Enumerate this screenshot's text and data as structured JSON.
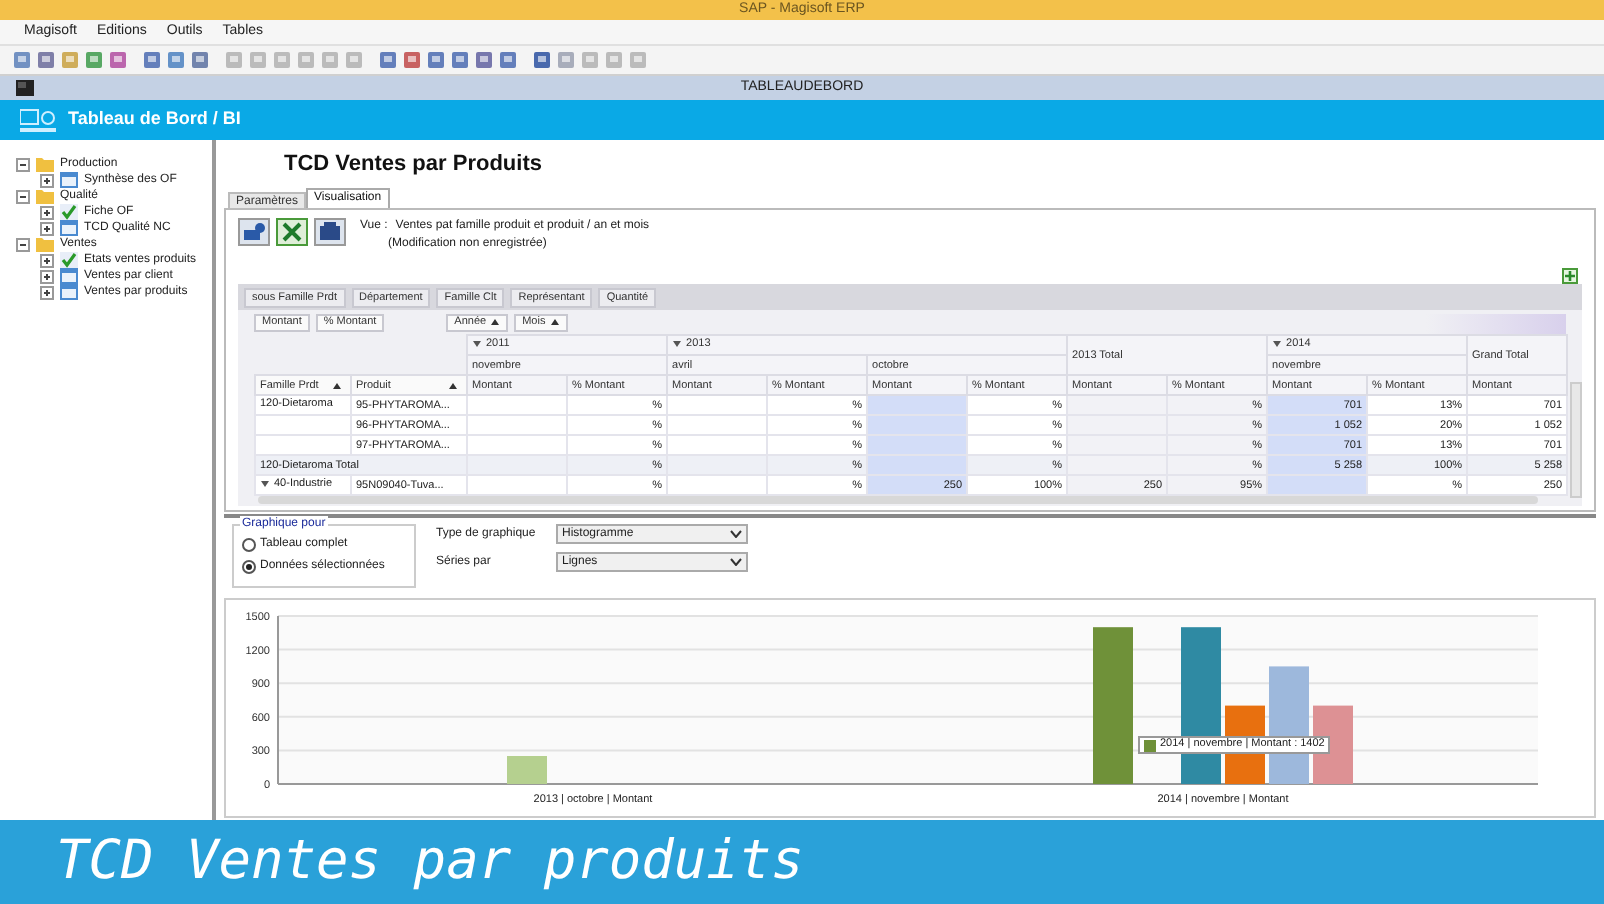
{
  "window": {
    "title": "SAP - Magisoft ERP"
  },
  "menu": [
    "Magisoft",
    "Editions",
    "Outils",
    "Tables"
  ],
  "document_bar": {
    "title": "TABLEAUDEBORD"
  },
  "module_bar": {
    "title": "Tableau de Bord / BI"
  },
  "tree": [
    {
      "label": "Production",
      "kind": "folder",
      "expanded": true,
      "children": [
        {
          "label": "Synthèse des OF",
          "kind": "report",
          "expanded": false
        }
      ]
    },
    {
      "label": "Qualité",
      "kind": "folder",
      "expanded": true,
      "children": [
        {
          "label": "Fiche OF",
          "kind": "check",
          "expanded": false
        },
        {
          "label": "TCD Qualité NC",
          "kind": "report",
          "expanded": false
        }
      ]
    },
    {
      "label": "Ventes",
      "kind": "folder",
      "expanded": true,
      "children": [
        {
          "label": "Etats ventes produits",
          "kind": "check",
          "expanded": false
        },
        {
          "label": "Ventes par client",
          "kind": "report",
          "expanded": false
        },
        {
          "label": "Ventes par produits",
          "kind": "report",
          "expanded": false
        }
      ]
    }
  ],
  "page_title": "TCD Ventes par Produits",
  "tabs": [
    {
      "label": "Paramètres",
      "selected": false
    },
    {
      "label": "Visualisation",
      "selected": true
    }
  ],
  "view": {
    "label": "Vue :",
    "description": "Ventes pat famille produit et produit / an et mois",
    "note": "(Modification non enregistrée)"
  },
  "filter_fields": [
    "sous Famille Prdt",
    "Département",
    "Famille Clt",
    "Représentant",
    "Quantité"
  ],
  "data_fields": [
    {
      "label": "Montant",
      "kind": "field"
    },
    {
      "label": "% Montant",
      "kind": "field"
    },
    {
      "label": "Année",
      "kind": "sort",
      "ascending": true
    },
    {
      "label": "Mois",
      "kind": "sort",
      "ascending": true
    }
  ],
  "column_groups": [
    {
      "kind": "year",
      "label": "2011",
      "expanded": true,
      "months": [
        "novembre"
      ]
    },
    {
      "kind": "year",
      "label": "2013",
      "expanded": true,
      "months": [
        "avril",
        "octobre"
      ]
    },
    {
      "kind": "total",
      "label": "2013 Total"
    },
    {
      "kind": "year",
      "label": "2014",
      "expanded": true,
      "months": [
        "novembre"
      ]
    },
    {
      "kind": "grand_total",
      "label": "Grand Total"
    }
  ],
  "row_headers": [
    {
      "label": "Famille Prdt",
      "ascending": true
    },
    {
      "label": "Produit",
      "ascending": true
    }
  ],
  "value_columns": [
    {
      "label": "Montant",
      "selected": false
    },
    {
      "label": "% Montant",
      "selected": false
    },
    {
      "label": "Montant",
      "selected": false
    },
    {
      "label": "% Montant",
      "selected": false
    },
    {
      "label": "Montant",
      "selected": true
    },
    {
      "label": "% Montant",
      "selected": false
    },
    {
      "label": "Montant",
      "selected": false
    },
    {
      "label": "% Montant",
      "selected": false
    },
    {
      "label": "Montant",
      "selected": true
    },
    {
      "label": "% Montant",
      "selected": false
    },
    {
      "label": "Montant",
      "selected": false
    }
  ],
  "rows": [
    {
      "kind": "item",
      "family": "120-Dietaroma",
      "product": "95-PHYTAROMA...",
      "cells": [
        null,
        "%",
        null,
        "%",
        null,
        "%",
        null,
        "%",
        "701",
        "13%",
        "701"
      ]
    },
    {
      "kind": "item",
      "product": "96-PHYTAROMA...",
      "cells": [
        null,
        "%",
        null,
        "%",
        null,
        "%",
        null,
        "%",
        "1 052",
        "20%",
        "1 052"
      ]
    },
    {
      "kind": "item",
      "product": "97-PHYTAROMA...",
      "cells": [
        null,
        "%",
        null,
        "%",
        null,
        "%",
        null,
        "%",
        "701",
        "13%",
        "701"
      ]
    },
    {
      "kind": "total",
      "family": "120-Dietaroma Total",
      "cells": [
        null,
        "%",
        null,
        "%",
        null,
        "%",
        null,
        "%",
        "5 258",
        "100%",
        "5 258"
      ]
    },
    {
      "kind": "item",
      "family": "40-Industrie",
      "expanded": true,
      "product": "95N09040-Tuva...",
      "cells": [
        null,
        "%",
        null,
        "%",
        "250",
        "100%",
        "250",
        "95%",
        null,
        "%",
        "250"
      ]
    }
  ],
  "chart_options": {
    "group_title": "Graphique pour",
    "radios": [
      {
        "label": "Tableau complet",
        "selected": false
      },
      {
        "label": "Données sélectionnées",
        "selected": true
      }
    ],
    "selects": [
      {
        "label": "Type de graphique",
        "value": "Histogramme"
      },
      {
        "label": "Séries par",
        "value": "Lignes"
      }
    ]
  },
  "chart_data": {
    "type": "bar",
    "categories": [
      "2013 | octobre | Montant",
      "2014 | novembre | Montant"
    ],
    "series": [
      {
        "color": "#6f9139",
        "values": [
          null,
          1400
        ]
      },
      {
        "color": "#b5d08f",
        "values": [
          250,
          null
        ]
      },
      {
        "color": "#2f8aa3",
        "values": [
          null,
          1400
        ]
      },
      {
        "color": "#e8700f",
        "values": [
          null,
          700
        ]
      },
      {
        "color": "#9db8dc",
        "values": [
          null,
          1050
        ]
      },
      {
        "color": "#dd9194",
        "values": [
          null,
          700
        ]
      }
    ],
    "grid": true,
    "ylim": [
      0,
      1500
    ],
    "yticks": [
      0,
      300,
      600,
      900,
      1200,
      1500
    ],
    "annotations": [
      {
        "text": "2014 | novembre | Montant : 1402"
      }
    ]
  },
  "banner": {
    "text": "TCD Ventes par produits"
  }
}
